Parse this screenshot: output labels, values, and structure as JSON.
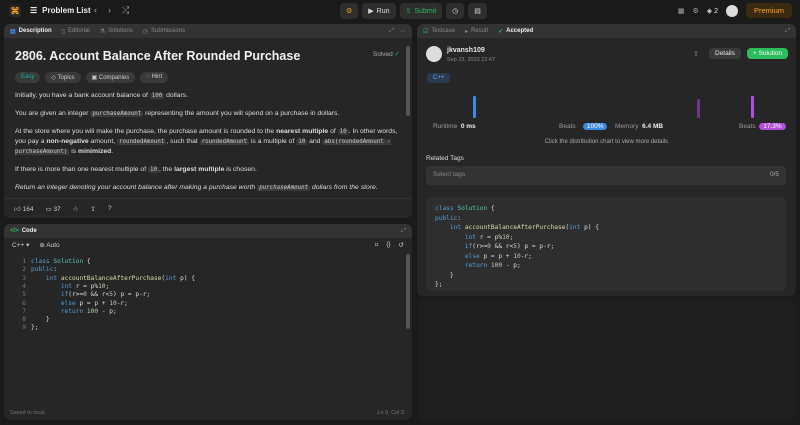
{
  "topbar": {
    "title": "Problem List",
    "run": "Run",
    "submit": "Submit",
    "streak": "2",
    "premium": "Premium"
  },
  "desc_tabs": [
    "Description",
    "Editorial",
    "Solutions",
    "Submissions"
  ],
  "problem": {
    "title": "2806. Account Balance After Rounded Purchase",
    "status": "Solved",
    "difficulty": "Easy",
    "topics": "Topics",
    "companies": "Companies",
    "hint": "Hint",
    "p1": "Initially, you have a bank account balance of ",
    "p1_code": "100",
    "p1_end": " dollars.",
    "p2a": "You are given an integer ",
    "p2_code": "purchaseAmount",
    "p2b": " representing the amount you will spend on a purchase in dollars.",
    "p3a": "At the store where you will make the purchase, the purchase amount is rounded to the ",
    "p3_bold": "nearest multiple",
    "p3b": " of ",
    "p3_code1": "10",
    "p3c": ". In other words, you pay a ",
    "p3_bold2": "non-negative",
    "p3d": " amount, ",
    "p3_code2": "roundedAmount",
    "p3e": ", such that ",
    "p3_code3": "roundedAmount",
    "p3f": " is a multiple of ",
    "p3_code4": "10",
    "p3g": " and ",
    "p3_code5": "abs(roundedAmount - purchaseAmount)",
    "p3h": " is ",
    "p3_bold3": "minimized",
    "p3i": ".",
    "p4a": "If there is more than one nearest multiple of ",
    "p4_code": "10",
    "p4b": ", the ",
    "p4_bold": "largest multiple",
    "p4c": " is chosen.",
    "p5a": "Return an integer denoting your account balance after making a purchase worth ",
    "p5_code": "purchaseAmount",
    "p5b": " dollars from the store.",
    "likes": "164",
    "comments": "37"
  },
  "code_panel": {
    "tab": "Code",
    "lang": "C++",
    "mode": "Auto",
    "saved": "Saved to local",
    "cursor": "Ln 9, Col 3",
    "lines": [
      "1",
      "2",
      "3",
      "4",
      "5",
      "6",
      "7",
      "8",
      "9"
    ]
  },
  "result_tabs": [
    "Testcase",
    "Result",
    "Accepted"
  ],
  "result": {
    "user": "jkvansh109",
    "date": "Sep 23, 2023 22:47",
    "details": "Details",
    "solution": "+ Solution",
    "lang": "C++",
    "runtime_label": "Runtime",
    "runtime": "0 ms",
    "beats": "Beats",
    "runtime_beats": "100%",
    "memory_label": "Memory",
    "memory": "6.4 MB",
    "memory_beats": "17.3%",
    "hint": "Click the distribution chart to view more details",
    "related": "Related Tags",
    "select_tags": "Select tags",
    "tag_count": "0/5"
  }
}
